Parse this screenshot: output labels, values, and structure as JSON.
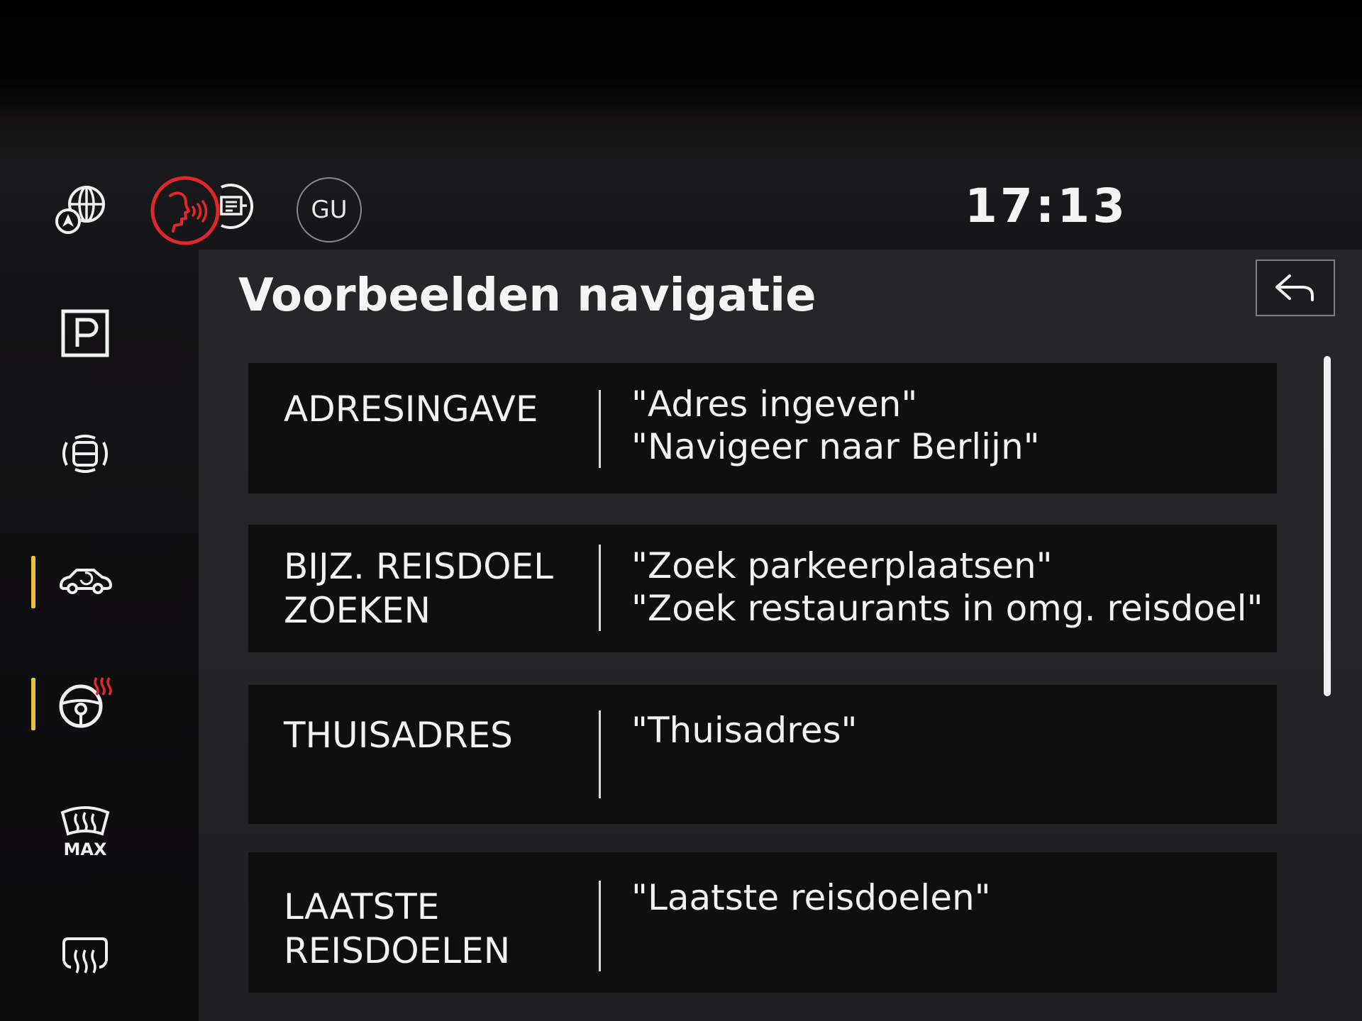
{
  "status_bar": {
    "clock": "17:13",
    "profile_badge": "GU",
    "icons": [
      "globe-navigation-icon",
      "voice-control-icon",
      "media-text-icon"
    ]
  },
  "sidebar": {
    "items": [
      {
        "icon": "parking-icon",
        "label": "P"
      },
      {
        "icon": "parking-sensor-icon"
      },
      {
        "icon": "car-view-icon",
        "active": true
      },
      {
        "icon": "heated-steering-wheel-icon",
        "active": true
      },
      {
        "icon": "windshield-defrost-max-icon",
        "label": "MAX"
      },
      {
        "icon": "rear-window-defrost-icon"
      }
    ]
  },
  "main": {
    "title": "Voorbeelden navigatie",
    "rows": [
      {
        "label": "ADRESINGAVE",
        "examples": [
          "\"Adres ingeven\"",
          "\"Navigeer naar Berlijn\""
        ]
      },
      {
        "label": "BIJZ. REISDOEL\nZOEKEN",
        "examples": [
          "\"Zoek parkeerplaatsen\"",
          "\"Zoek restaurants in omg. reisdoel\""
        ]
      },
      {
        "label": "THUISADRES",
        "examples": [
          "\"Thuisadres\""
        ]
      },
      {
        "label": "LAATSTE\nREISDOELEN",
        "examples": [
          "\"Laatste reisdoelen\""
        ]
      }
    ]
  },
  "colors": {
    "accent_active": "#e9c23a",
    "voice_active": "#e0282a",
    "heat_red": "#e0282a",
    "row_background": "#0f0f10",
    "panel_background": "#252527"
  }
}
